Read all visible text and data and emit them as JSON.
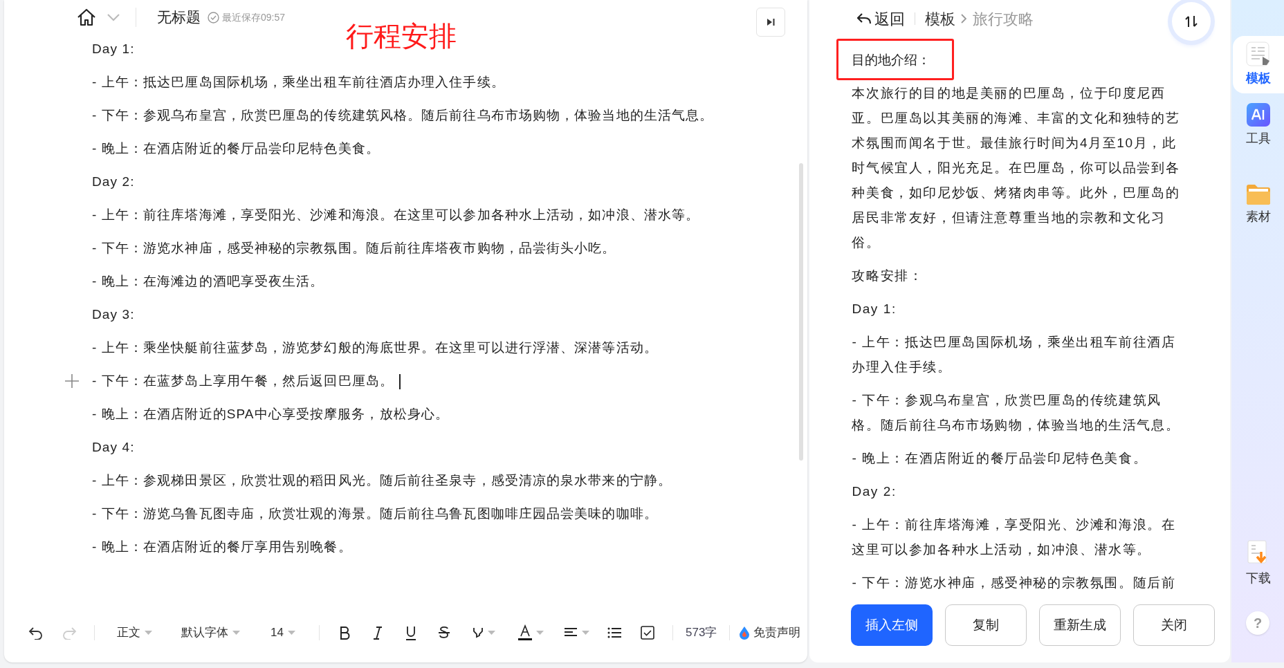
{
  "header": {
    "title": "无标题",
    "save_status": "最近保存09:57"
  },
  "annotation": "行程安排",
  "document": {
    "paragraphs": [
      {
        "text": "Day 1:",
        "has_cursor": false
      },
      {
        "text": "- 上午：抵达巴厘岛国际机场，乘坐出租车前往酒店办理入住手续。",
        "has_cursor": false
      },
      {
        "text": "- 下午：参观乌布皇宫，欣赏巴厘岛的传统建筑风格。随后前往乌布市场购物，体验当地的生活气息。",
        "has_cursor": false
      },
      {
        "text": "- 晚上：在酒店附近的餐厅品尝印尼特色美食。",
        "has_cursor": false
      },
      {
        "text": "Day 2:",
        "has_cursor": false
      },
      {
        "text": "- 上午：前往库塔海滩，享受阳光、沙滩和海浪。在这里可以参加各种水上活动，如冲浪、潜水等。",
        "has_cursor": false
      },
      {
        "text": "- 下午：游览水神庙，感受神秘的宗教氛围。随后前往库塔夜市购物，品尝街头小吃。",
        "has_cursor": false
      },
      {
        "text": "- 晚上：在海滩边的酒吧享受夜生活。",
        "has_cursor": false
      },
      {
        "text": "Day 3:",
        "has_cursor": false
      },
      {
        "text": "- 上午：乘坐快艇前往蓝梦岛，游览梦幻般的海底世界。在这里可以进行浮潜、深潜等活动。",
        "has_cursor": false
      },
      {
        "text": "- 下午：在蓝梦岛上享用午餐，然后返回巴厘岛。",
        "has_cursor": true
      },
      {
        "text": "- 晚上：在酒店附近的SPA中心享受按摩服务，放松身心。",
        "has_cursor": false
      },
      {
        "text": "Day 4:",
        "has_cursor": false
      },
      {
        "text": "- 上午：参观梯田景区，欣赏壮观的稻田风光。随后前往圣泉寺，感受清凉的泉水带来的宁静。",
        "has_cursor": false
      },
      {
        "text": "- 下午：游览乌鲁瓦图寺庙，欣赏壮观的海景。随后前往乌鲁瓦图咖啡庄园品尝美味的咖啡。",
        "has_cursor": false
      },
      {
        "text": "- 晚上：在酒店附近的餐厅享用告别晚餐。",
        "has_cursor": false
      }
    ]
  },
  "toolbar": {
    "paragraph_style": "正文",
    "font": "默认字体",
    "font_size": "14",
    "word_count": "573字",
    "disclaimer": "免责声明"
  },
  "template_panel": {
    "back": "返回",
    "breadcrumb": [
      {
        "label": "模板",
        "current": false
      },
      {
        "label": "旅行攻略",
        "current": true
      }
    ],
    "heading": "目的地介绍：",
    "paragraphs": [
      "本次旅行的目的地是美丽的巴厘岛，位于印度尼西亚。巴厘岛以其美丽的海滩、丰富的文化和独特的艺术氛围而闻名于世。最佳旅行时间为4月至10月，此时气候宜人，阳光充足。在巴厘岛，你可以品尝到各种美食，如印尼炒饭、烤猪肉串等。此外，巴厘岛的居民非常友好，但请注意尊重当地的宗教和文化习俗。",
      "攻略安排：",
      "Day 1:",
      "- 上午：抵达巴厘岛国际机场，乘坐出租车前往酒店办理入住手续。",
      "- 下午：参观乌布皇宫，欣赏巴厘岛的传统建筑风格。随后前往乌布市场购物，体验当地的生活气息。",
      "- 晚上：在酒店附近的餐厅品尝印尼特色美食。",
      "Day 2:",
      "- 上午：前往库塔海滩，享受阳光、沙滩和海浪。在这里可以参加各种水上活动，如冲浪、潜水等。",
      "- 下午：游览水神庙，感受神秘的宗教氛围。随后前"
    ],
    "buttons": [
      {
        "label": "插入左侧",
        "primary": true
      },
      {
        "label": "复制",
        "primary": false
      },
      {
        "label": "重新生成",
        "primary": false
      },
      {
        "label": "关闭",
        "primary": false
      }
    ]
  },
  "side_tabs": [
    {
      "label": "模板",
      "kind": "template",
      "selected": true
    },
    {
      "label": "工具",
      "kind": "ai",
      "selected": false
    },
    {
      "label": "素材",
      "kind": "folder",
      "selected": false
    },
    {
      "label": "下载",
      "kind": "download",
      "selected": false
    }
  ],
  "help": "?"
}
